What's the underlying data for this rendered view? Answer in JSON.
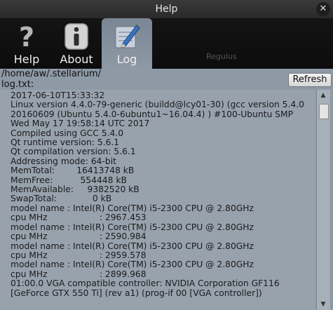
{
  "window": {
    "title": "Help",
    "close_symbol": "✕"
  },
  "tabs": [
    {
      "label": "Help",
      "icon": "question-mark-icon",
      "active": false
    },
    {
      "label": "About",
      "icon": "info-icon",
      "active": false
    },
    {
      "label": "Log",
      "icon": "pencil-notepad-icon",
      "active": true
    }
  ],
  "background_word": "Regulus",
  "log": {
    "path_line1": "/home/aw/.stellarium/",
    "path_line2": "log.txt:",
    "refresh_label": "Refresh",
    "content": "2017-06-10T15:33:32\nLinux version 4.4.0-79-generic (buildd@lcy01-30) (gcc version 5.4.0\n20160609 (Ubuntu 5.4.0-6ubuntu1~16.04.4) ) #100-Ubuntu SMP\nWed May 17 19:58:14 UTC 2017\nCompiled using GCC 5.4.0\nQt runtime version: 5.6.1\nQt compilation version: 5.6.1\nAddressing mode: 64-bit\nMemTotal:        16413748 kB\nMemFree:          554448 kB\nMemAvailable:     9382520 kB\nSwapTotal:             0 kB\nmodel name : Intel(R) Core(TM) i5-2300 CPU @ 2.80GHz\ncpu MHz                   : 2967.453\nmodel name : Intel(R) Core(TM) i5-2300 CPU @ 2.80GHz\ncpu MHz                   : 2590.984\nmodel name : Intel(R) Core(TM) i5-2300 CPU @ 2.80GHz\ncpu MHz                   : 2959.578\nmodel name : Intel(R) Core(TM) i5-2300 CPU @ 2.80GHz\ncpu MHz                   : 2899.968\n01:00.0 VGA compatible controller: NVIDIA Corporation GF116\n[GeForce GTX 550 Ti] (rev a1) (prog-if 00 [VGA controller])"
  },
  "colors": {
    "panel": "#8e99a6",
    "active_tab": "#8e99a6",
    "titlebar": "#2f2f2f"
  }
}
